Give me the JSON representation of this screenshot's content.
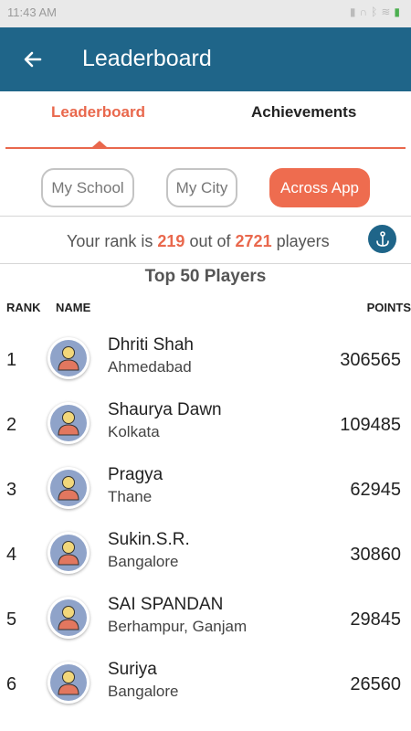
{
  "status_bar": {
    "time": "11:43 AM"
  },
  "app_bar": {
    "title": "Leaderboard"
  },
  "tabs": [
    {
      "label": "Leaderboard",
      "active": true
    },
    {
      "label": "Achievements",
      "active": false
    }
  ],
  "filters": [
    {
      "label": "My School",
      "selected": false
    },
    {
      "label": "My City",
      "selected": false
    },
    {
      "label": "Across App",
      "selected": true
    }
  ],
  "rank_summary": {
    "prefix": "Your rank is",
    "rank": "219",
    "middle": "out of",
    "total": "2721",
    "suffix": "players"
  },
  "section_title": "Top 50 Players",
  "columns": {
    "rank": "RANK",
    "name": "NAME",
    "points": "POINTS"
  },
  "players": [
    {
      "rank": "1",
      "name": "Dhriti Shah",
      "city": "Ahmedabad",
      "points": "306565"
    },
    {
      "rank": "2",
      "name": "Shaurya Dawn",
      "city": "Kolkata",
      "points": "109485"
    },
    {
      "rank": "3",
      "name": "Pragya",
      "city": "Thane",
      "points": "62945"
    },
    {
      "rank": "4",
      "name": "Sukin.S.R.",
      "city": "Bangalore",
      "points": "30860"
    },
    {
      "rank": "5",
      "name": "SAI SPANDAN",
      "city": "Berhampur, Ganjam",
      "points": "29845"
    },
    {
      "rank": "6",
      "name": "Suriya",
      "city": "Bangalore",
      "points": "26560"
    }
  ],
  "colors": {
    "primary": "#1f6589",
    "accent": "#e9684d",
    "avatar_bg": "#8fa3c9",
    "avatar_head": "#f2d77a",
    "avatar_body": "#e2775f"
  },
  "icons": {
    "back": "arrow-left-icon",
    "info": "anchor-icon",
    "avatar": "user-avatar-icon"
  }
}
